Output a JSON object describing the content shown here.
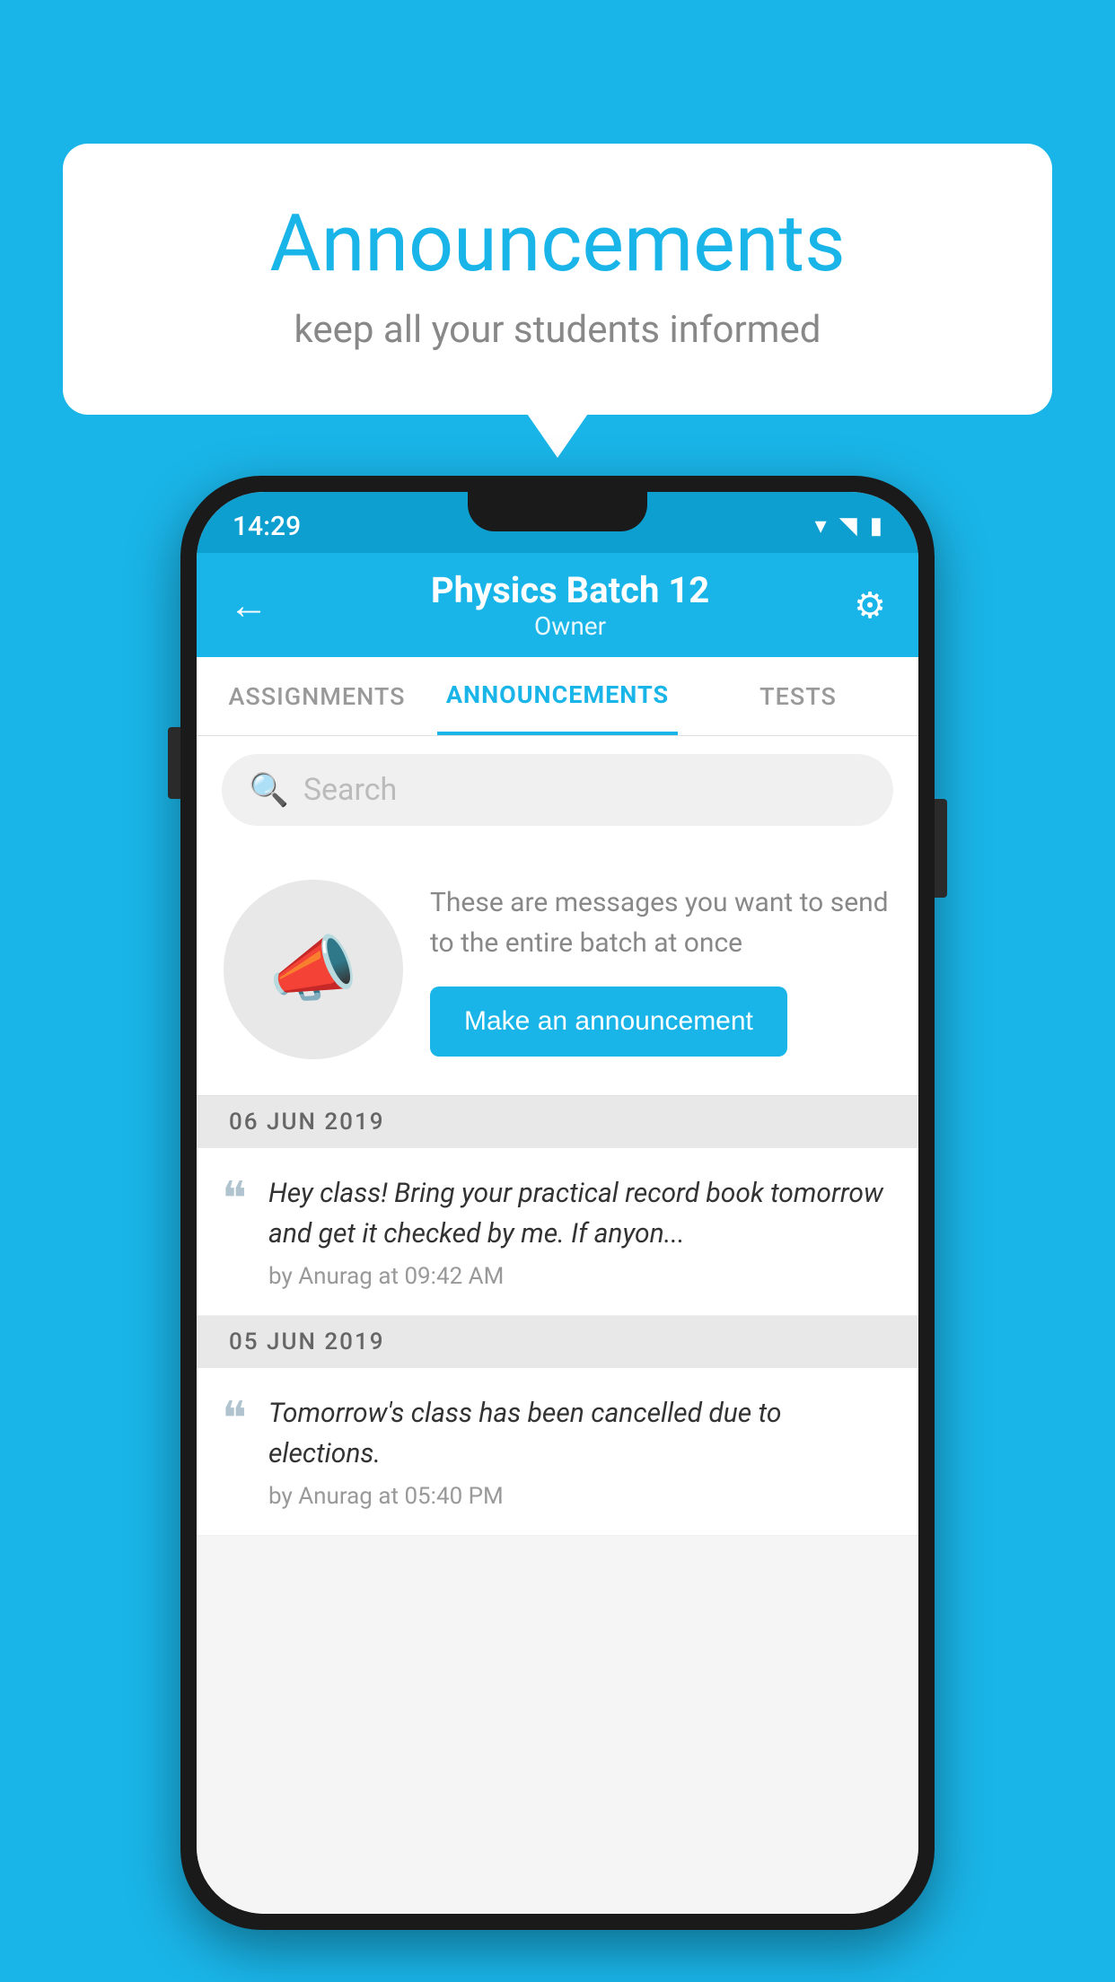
{
  "background_color": "#1ab5e8",
  "speech_bubble": {
    "title": "Announcements",
    "subtitle": "keep all your students informed"
  },
  "phone": {
    "status_bar": {
      "time": "14:29",
      "icons": [
        "wifi",
        "signal",
        "battery"
      ]
    },
    "app_bar": {
      "title": "Physics Batch 12",
      "subtitle": "Owner",
      "back_label": "←",
      "settings_label": "⚙"
    },
    "tabs": [
      {
        "label": "ASSIGNMENTS",
        "active": false
      },
      {
        "label": "ANNOUNCEMENTS",
        "active": true
      },
      {
        "label": "TESTS",
        "active": false
      },
      {
        "label": "...",
        "active": false
      }
    ],
    "search": {
      "placeholder": "Search"
    },
    "announcement_prompt": {
      "message": "These are messages you want to send to the entire batch at once",
      "button_label": "Make an announcement"
    },
    "announcements": [
      {
        "date": "06  JUN  2019",
        "text": "Hey class! Bring your practical record book tomorrow and get it checked by me. If anyon...",
        "author": "by Anurag at 09:42 AM"
      },
      {
        "date": "05  JUN  2019",
        "text": "Tomorrow's class has been cancelled due to elections.",
        "author": "by Anurag at 05:40 PM"
      }
    ]
  }
}
